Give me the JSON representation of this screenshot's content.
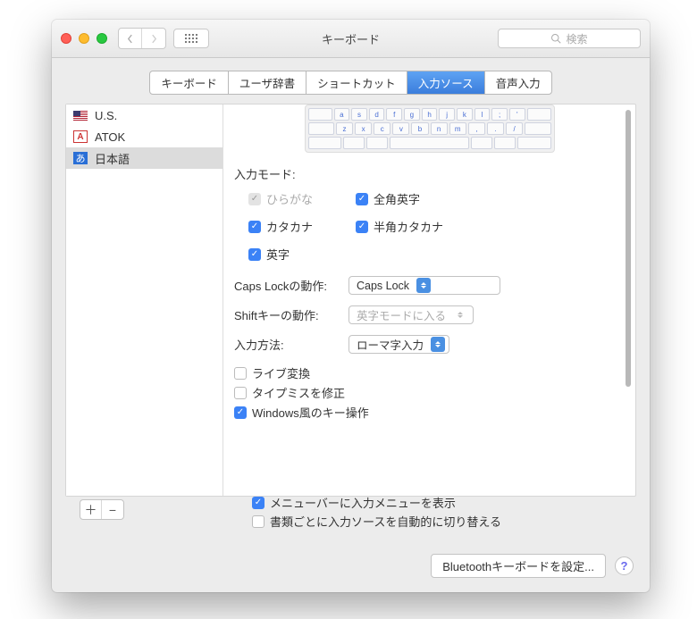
{
  "window": {
    "title": "キーボード",
    "search_placeholder": "検索"
  },
  "tabs": [
    {
      "label": "キーボード"
    },
    {
      "label": "ユーザ辞書"
    },
    {
      "label": "ショートカット"
    },
    {
      "label": "入力ソース"
    },
    {
      "label": "音声入力"
    }
  ],
  "active_tab": 3,
  "sidebar": {
    "items": [
      {
        "label": "U.S.",
        "icon": "flag-us"
      },
      {
        "label": "ATOK",
        "icon": "atok"
      },
      {
        "label": "日本語",
        "icon": "ja-hiragana"
      }
    ],
    "selected": 2
  },
  "keyboard_preview": {
    "row1": [
      "a",
      "s",
      "d",
      "f",
      "g",
      "h",
      "j",
      "k",
      "l",
      ";",
      "'"
    ],
    "row2": [
      "z",
      "x",
      "c",
      "v",
      "b",
      "n",
      "m",
      ",",
      ".",
      "/"
    ]
  },
  "input_mode": {
    "label": "入力モード:",
    "options": [
      {
        "label": "ひらがな",
        "checked": true,
        "disabled": true
      },
      {
        "label": "全角英字",
        "checked": true
      },
      {
        "label": "カタカナ",
        "checked": true
      },
      {
        "label": "半角カタカナ",
        "checked": true
      },
      {
        "label": "英字",
        "checked": true
      }
    ]
  },
  "caps_lock": {
    "label": "Caps Lockの動作:",
    "value": "Caps Lock"
  },
  "shift_key": {
    "label": "Shiftキーの動作:",
    "value": "英字モードに入る"
  },
  "input_method": {
    "label": "入力方法:",
    "value": "ローマ字入力"
  },
  "options": [
    {
      "label": "ライブ変換",
      "checked": false
    },
    {
      "label": "タイプミスを修正",
      "checked": false
    },
    {
      "label": "Windows風のキー操作",
      "checked": true
    }
  ],
  "bottom": [
    {
      "label": "メニューバーに入力メニューを表示",
      "checked": true
    },
    {
      "label": "書類ごとに入力ソースを自動的に切り替える",
      "checked": false
    }
  ],
  "footer": {
    "bluetooth": "Bluetoothキーボードを設定..."
  }
}
